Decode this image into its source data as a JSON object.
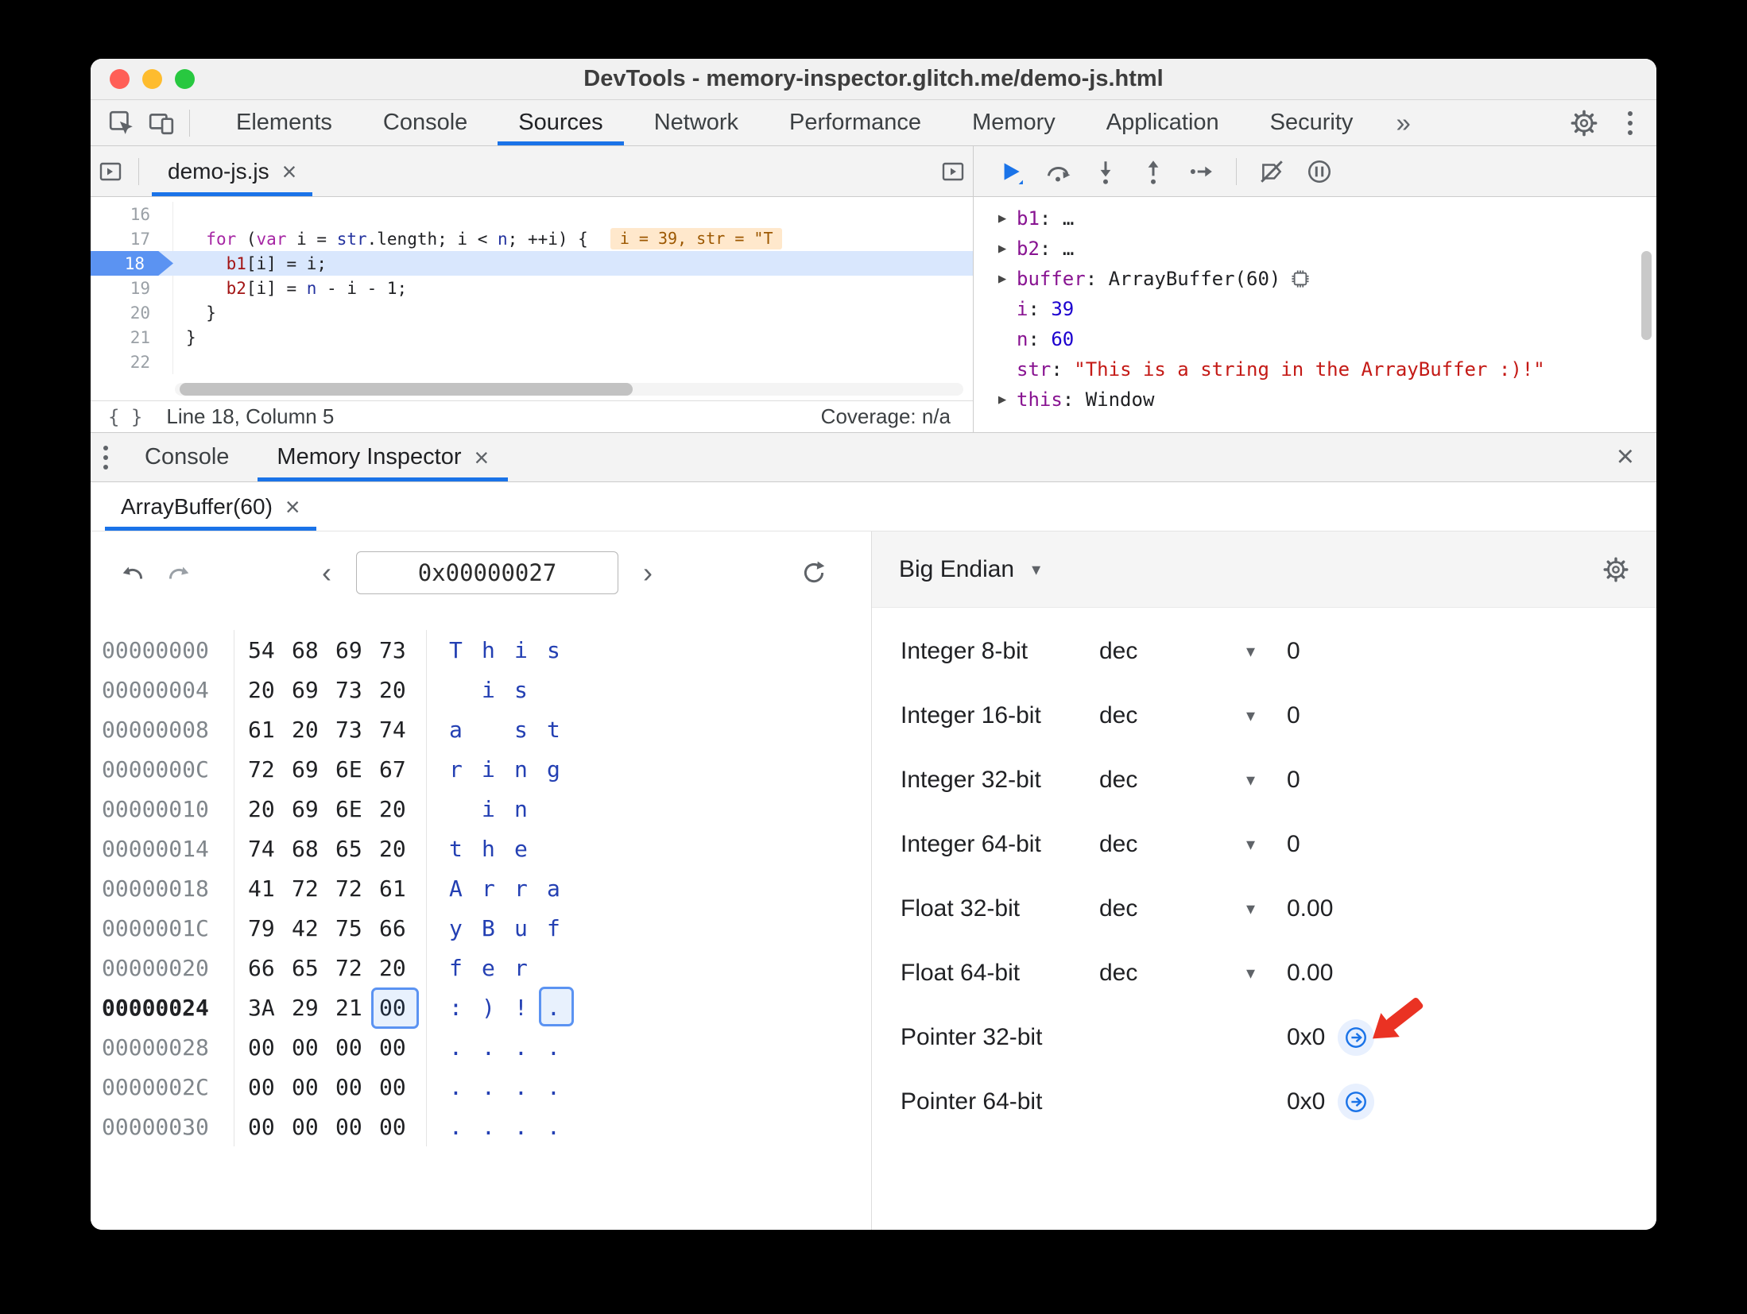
{
  "window_title": "DevTools - memory-inspector.glitch.me/demo-js.html",
  "colors": {
    "accent": "#1a73e8",
    "traffic_close": "#ff5f57",
    "traffic_minimize": "#febc2e",
    "traffic_zoom": "#28c840",
    "paused_line": "#d9e7fd",
    "annotation_arrow": "#ea3223"
  },
  "glyphs": {
    "close": "×",
    "caret": "▾",
    "more": "»",
    "prev": "‹",
    "next": "›",
    "expand": "▶",
    "braces": "{ }",
    "colon_sep": ": "
  },
  "main_tabs": {
    "items": [
      "Elements",
      "Console",
      "Sources",
      "Network",
      "Performance",
      "Memory",
      "Application",
      "Security"
    ],
    "active": "Sources"
  },
  "sources": {
    "file_tab": "demo-js.js",
    "code_lines": [
      {
        "num": "16",
        "tokens": []
      },
      {
        "num": "17",
        "tokens": [
          {
            "t": "  ",
            "c": "pl"
          },
          {
            "t": "for",
            "c": "kw"
          },
          {
            "t": " (",
            "c": "pl"
          },
          {
            "t": "var",
            "c": "kw"
          },
          {
            "t": " i = ",
            "c": "pl"
          },
          {
            "t": "str",
            "c": "nav"
          },
          {
            "t": ".length; ",
            "c": "pl"
          },
          {
            "t": "i",
            "c": "pl"
          },
          {
            "t": " < ",
            "c": "pl"
          },
          {
            "t": "n",
            "c": "nav"
          },
          {
            "t": "; ++i) {",
            "c": "pl"
          }
        ],
        "badge": "i = 39, str = \"T"
      },
      {
        "num": "18",
        "active": true,
        "tokens": [
          {
            "t": "    ",
            "c": "pl"
          },
          {
            "t": "b1",
            "c": "lv"
          },
          {
            "t": "[i] = i;",
            "c": "pl"
          }
        ]
      },
      {
        "num": "19",
        "tokens": [
          {
            "t": "    ",
            "c": "pl"
          },
          {
            "t": "b2",
            "c": "lv"
          },
          {
            "t": "[i] = ",
            "c": "pl"
          },
          {
            "t": "n",
            "c": "nav"
          },
          {
            "t": " - i - 1;",
            "c": "pl"
          }
        ]
      },
      {
        "num": "20",
        "tokens": [
          {
            "t": "  }",
            "c": "pl"
          }
        ]
      },
      {
        "num": "21",
        "tokens": [
          {
            "t": "}",
            "c": "pl"
          }
        ]
      },
      {
        "num": "22",
        "tokens": []
      }
    ],
    "status_position": "Line 18, Column 5",
    "status_coverage": "Coverage: n/a"
  },
  "debugger": {
    "scope_items": [
      {
        "arrow": true,
        "name": "b1",
        "value": "…",
        "vc": "dim"
      },
      {
        "arrow": true,
        "name": "b2",
        "value": "…",
        "vc": "dim"
      },
      {
        "arrow": true,
        "name": "buffer",
        "value": "ArrayBuffer(60)",
        "vc": "obj",
        "icon": "memory"
      },
      {
        "arrow": false,
        "name": "i",
        "value": "39",
        "vc": "num"
      },
      {
        "arrow": false,
        "name": "n",
        "value": "60",
        "vc": "num"
      },
      {
        "arrow": false,
        "name": "str",
        "value": "\"This is a string in the ArrayBuffer :)!\"",
        "vc": "str"
      },
      {
        "arrow": true,
        "name": "this",
        "value": "Window",
        "vc": "obj"
      }
    ]
  },
  "drawer": {
    "tabs": [
      "Console",
      "Memory Inspector"
    ],
    "active": "Memory Inspector"
  },
  "memory": {
    "buffer_tab": "ArrayBuffer(60)",
    "address_value": "0x00000027",
    "endianness": "Big Endian",
    "selected": {
      "row": 9,
      "col": 3
    },
    "rows": [
      {
        "addr": "00000000",
        "bytes": [
          "54",
          "68",
          "69",
          "73"
        ],
        "ascii": [
          "T",
          "h",
          "i",
          "s"
        ]
      },
      {
        "addr": "00000004",
        "bytes": [
          "20",
          "69",
          "73",
          "20"
        ],
        "ascii": [
          "",
          "i",
          "s",
          ""
        ]
      },
      {
        "addr": "00000008",
        "bytes": [
          "61",
          "20",
          "73",
          "74"
        ],
        "ascii": [
          "a",
          "",
          "s",
          "t"
        ]
      },
      {
        "addr": "0000000C",
        "bytes": [
          "72",
          "69",
          "6E",
          "67"
        ],
        "ascii": [
          "r",
          "i",
          "n",
          "g"
        ]
      },
      {
        "addr": "00000010",
        "bytes": [
          "20",
          "69",
          "6E",
          "20"
        ],
        "ascii": [
          "",
          "i",
          "n",
          ""
        ]
      },
      {
        "addr": "00000014",
        "bytes": [
          "74",
          "68",
          "65",
          "20"
        ],
        "ascii": [
          "t",
          "h",
          "e",
          ""
        ]
      },
      {
        "addr": "00000018",
        "bytes": [
          "41",
          "72",
          "72",
          "61"
        ],
        "ascii": [
          "A",
          "r",
          "r",
          "a"
        ]
      },
      {
        "addr": "0000001C",
        "bytes": [
          "79",
          "42",
          "75",
          "66"
        ],
        "ascii": [
          "y",
          "B",
          "u",
          "f"
        ]
      },
      {
        "addr": "00000020",
        "bytes": [
          "66",
          "65",
          "72",
          "20"
        ],
        "ascii": [
          "f",
          "e",
          "r",
          ""
        ]
      },
      {
        "addr": "00000024",
        "bold": true,
        "bytes": [
          "3A",
          "29",
          "21",
          "00"
        ],
        "ascii": [
          ":",
          ")",
          "!",
          "."
        ]
      },
      {
        "addr": "00000028",
        "bytes": [
          "00",
          "00",
          "00",
          "00"
        ],
        "ascii": [
          ".",
          ".",
          ".",
          "."
        ]
      },
      {
        "addr": "0000002C",
        "bytes": [
          "00",
          "00",
          "00",
          "00"
        ],
        "ascii": [
          ".",
          ".",
          ".",
          "."
        ]
      },
      {
        "addr": "00000030",
        "bytes": [
          "00",
          "00",
          "00",
          "00"
        ],
        "ascii": [
          ".",
          ".",
          ".",
          "."
        ]
      }
    ],
    "interpretations": [
      {
        "label": "Integer 8-bit",
        "fmt": "dec",
        "value": "0"
      },
      {
        "label": "Integer 16-bit",
        "fmt": "dec",
        "value": "0"
      },
      {
        "label": "Integer 32-bit",
        "fmt": "dec",
        "value": "0"
      },
      {
        "label": "Integer 64-bit",
        "fmt": "dec",
        "value": "0"
      },
      {
        "label": "Float 32-bit",
        "fmt": "dec",
        "value": "0.00"
      },
      {
        "label": "Float 64-bit",
        "fmt": "dec",
        "value": "0.00"
      },
      {
        "label": "Pointer 32-bit",
        "fmt": null,
        "value": "0x0",
        "jump": true
      },
      {
        "label": "Pointer 64-bit",
        "fmt": null,
        "value": "0x0",
        "jump": true
      }
    ]
  }
}
